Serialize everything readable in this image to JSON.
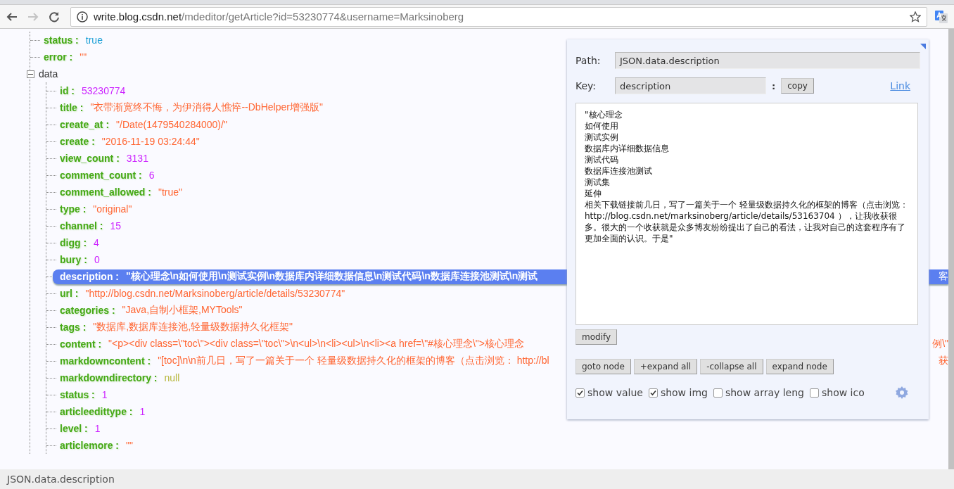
{
  "browser": {
    "url_host": "write.blog.csdn.net",
    "url_path": "/mdeditor/getArticle?id=53230774&username=Marksinoberg",
    "back_disabled": false,
    "forward_disabled": true
  },
  "tree": [
    {
      "key": "status :",
      "value": "true",
      "kind": "boolean"
    },
    {
      "key": "error :",
      "value": "\"\"",
      "kind": "string"
    },
    {
      "key": "data",
      "kind": "object",
      "expanded": true,
      "children": [
        {
          "key": "id :",
          "value": "53230774",
          "kind": "number",
          "selected": false
        },
        {
          "key": "title :",
          "value": "\"衣带渐宽终不悔，为伊消得人憔悴--DbHelper增强版\"",
          "kind": "string",
          "selected": false
        },
        {
          "key": "create_at :",
          "value": "\"/Date(1479540284000)/\"",
          "kind": "string",
          "selected": false
        },
        {
          "key": "create :",
          "value": "\"2016-11-19 03:24:44\"",
          "kind": "string",
          "selected": false
        },
        {
          "key": "view_count :",
          "value": "3131",
          "kind": "number",
          "selected": false
        },
        {
          "key": "comment_count :",
          "value": "6",
          "kind": "number",
          "selected": false
        },
        {
          "key": "comment_allowed :",
          "value": "\"true\"",
          "kind": "string",
          "selected": false
        },
        {
          "key": "type :",
          "value": "\"original\"",
          "kind": "string",
          "selected": false
        },
        {
          "key": "channel :",
          "value": "15",
          "kind": "number",
          "selected": false
        },
        {
          "key": "digg :",
          "value": "4",
          "kind": "number",
          "selected": false
        },
        {
          "key": "bury :",
          "value": "0",
          "kind": "number",
          "selected": false
        },
        {
          "key": "description :",
          "value": "\"核心理念\\n如何使用\\n测试实例\\n数据库内详细数据信息\\n测试代码\\n数据库连接池测试\\n测试",
          "tail": "客",
          "kind": "string",
          "selected": true
        },
        {
          "key": "url :",
          "value": "\"http://blog.csdn.net/Marksinoberg/article/details/53230774\"",
          "kind": "string",
          "selected": false
        },
        {
          "key": "categories :",
          "value": "\"Java,自制小框架,MYTools\"",
          "kind": "string",
          "selected": false
        },
        {
          "key": "tags :",
          "value": "\"数据库,数据库连接池,轻量级数据持久化框架\"",
          "kind": "string",
          "selected": false
        },
        {
          "key": "content :",
          "value": "\"<p><div class=\\\"toc\\\"><div class=\\\"toc\\\">\\n<ul>\\n<li><ul>\\n<li><a href=\\\"#核心理念\\\">核心理念",
          "tail": "例\\\"",
          "kind": "string",
          "selected": false
        },
        {
          "key": "markdowncontent :",
          "value": "\"[toc]\\n\\n前几日，写了一篇关于一个 轻量级数据持久化的框架的博客（点击浏览： http://bl",
          "tail": "获",
          "kind": "string",
          "selected": false
        },
        {
          "key": "markdowndirectory :",
          "value": "null",
          "kind": "null",
          "selected": false
        },
        {
          "key": "status :",
          "value": "1",
          "kind": "number",
          "selected": false
        },
        {
          "key": "articleedittype :",
          "value": "1",
          "kind": "number",
          "selected": false
        },
        {
          "key": "level :",
          "value": "1",
          "kind": "number",
          "selected": false
        },
        {
          "key": "articlemore :",
          "value": "\"\"",
          "kind": "string",
          "selected": false
        }
      ]
    }
  ],
  "panel": {
    "path_label": "Path:",
    "path": "JSON.data.description",
    "key_label": "Key:",
    "key": "description",
    "colon": ":",
    "copy": "copy",
    "link": "Link",
    "value_lines": [
      "\"核心理念",
      "如何使用",
      "测试实例",
      "数据库内详细数据信息",
      "测试代码",
      "数据库连接池测试",
      "测试集",
      "延伸",
      "相关下载链接前几日，写了一篇关于一个 轻量级数据持久化的框架的博客（点击浏览： http://blog.csdn.net/marksinoberg/article/details/53163704 ），让我收获很多。很大的一个收获就是众多博友纷纷提出了自己的看法，让我对自己的这套程序有了更加全面的认识。于是\""
    ],
    "modify": "modify",
    "actions": [
      "goto node",
      "+expand all",
      "-collapse all",
      "expand node"
    ],
    "options": [
      {
        "label": "show value",
        "checked": true
      },
      {
        "label": "show img",
        "checked": true
      },
      {
        "label": "show array leng",
        "checked": false
      },
      {
        "label": "show ico",
        "checked": false
      }
    ]
  },
  "status_bar": "JSON.data.description"
}
